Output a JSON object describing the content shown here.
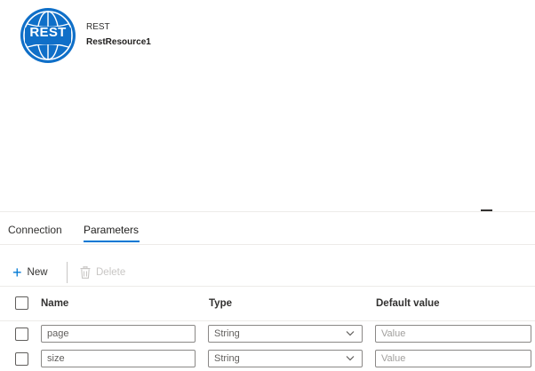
{
  "resource": {
    "logo_text": "REST",
    "type_label": "REST",
    "name": "RestResource1",
    "accent_color": "#0f6fc8"
  },
  "tabs": [
    {
      "label": "Connection",
      "active": false
    },
    {
      "label": "Parameters",
      "active": true
    }
  ],
  "toolbar": {
    "new_label": "New",
    "new_icon": "plus-icon",
    "delete_label": "Delete",
    "delete_icon": "trash-icon",
    "delete_disabled": true
  },
  "table": {
    "columns": [
      "Name",
      "Type",
      "Default value"
    ],
    "rows": [
      {
        "name": "page",
        "type": "String",
        "default_placeholder": "Value"
      },
      {
        "name": "size",
        "type": "String",
        "default_placeholder": "Value"
      }
    ]
  },
  "colors": {
    "tab_underline": "#0078d4",
    "icon_blue": "#0078d4",
    "disabled": "#c8c6c4"
  }
}
